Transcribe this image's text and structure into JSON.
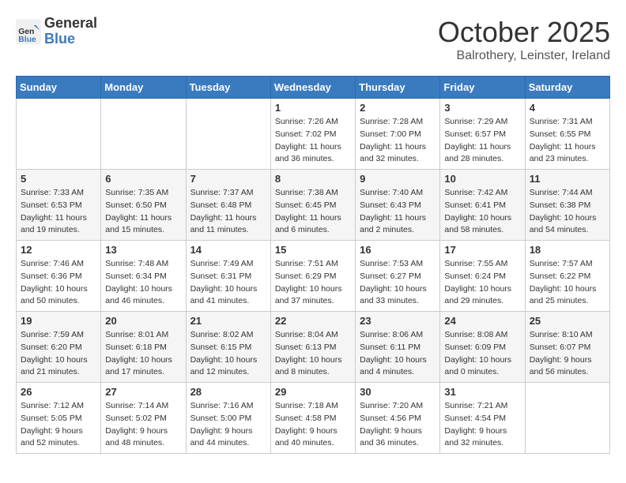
{
  "logo": {
    "general": "General",
    "blue": "Blue"
  },
  "title": "October 2025",
  "subtitle": "Balrothery, Leinster, Ireland",
  "days_of_week": [
    "Sunday",
    "Monday",
    "Tuesday",
    "Wednesday",
    "Thursday",
    "Friday",
    "Saturday"
  ],
  "weeks": [
    [
      {
        "day": "",
        "info": ""
      },
      {
        "day": "",
        "info": ""
      },
      {
        "day": "",
        "info": ""
      },
      {
        "day": "1",
        "info": "Sunrise: 7:26 AM\nSunset: 7:02 PM\nDaylight: 11 hours\nand 36 minutes."
      },
      {
        "day": "2",
        "info": "Sunrise: 7:28 AM\nSunset: 7:00 PM\nDaylight: 11 hours\nand 32 minutes."
      },
      {
        "day": "3",
        "info": "Sunrise: 7:29 AM\nSunset: 6:57 PM\nDaylight: 11 hours\nand 28 minutes."
      },
      {
        "day": "4",
        "info": "Sunrise: 7:31 AM\nSunset: 6:55 PM\nDaylight: 11 hours\nand 23 minutes."
      }
    ],
    [
      {
        "day": "5",
        "info": "Sunrise: 7:33 AM\nSunset: 6:53 PM\nDaylight: 11 hours\nand 19 minutes."
      },
      {
        "day": "6",
        "info": "Sunrise: 7:35 AM\nSunset: 6:50 PM\nDaylight: 11 hours\nand 15 minutes."
      },
      {
        "day": "7",
        "info": "Sunrise: 7:37 AM\nSunset: 6:48 PM\nDaylight: 11 hours\nand 11 minutes."
      },
      {
        "day": "8",
        "info": "Sunrise: 7:38 AM\nSunset: 6:45 PM\nDaylight: 11 hours\nand 6 minutes."
      },
      {
        "day": "9",
        "info": "Sunrise: 7:40 AM\nSunset: 6:43 PM\nDaylight: 11 hours\nand 2 minutes."
      },
      {
        "day": "10",
        "info": "Sunrise: 7:42 AM\nSunset: 6:41 PM\nDaylight: 10 hours\nand 58 minutes."
      },
      {
        "day": "11",
        "info": "Sunrise: 7:44 AM\nSunset: 6:38 PM\nDaylight: 10 hours\nand 54 minutes."
      }
    ],
    [
      {
        "day": "12",
        "info": "Sunrise: 7:46 AM\nSunset: 6:36 PM\nDaylight: 10 hours\nand 50 minutes."
      },
      {
        "day": "13",
        "info": "Sunrise: 7:48 AM\nSunset: 6:34 PM\nDaylight: 10 hours\nand 46 minutes."
      },
      {
        "day": "14",
        "info": "Sunrise: 7:49 AM\nSunset: 6:31 PM\nDaylight: 10 hours\nand 41 minutes."
      },
      {
        "day": "15",
        "info": "Sunrise: 7:51 AM\nSunset: 6:29 PM\nDaylight: 10 hours\nand 37 minutes."
      },
      {
        "day": "16",
        "info": "Sunrise: 7:53 AM\nSunset: 6:27 PM\nDaylight: 10 hours\nand 33 minutes."
      },
      {
        "day": "17",
        "info": "Sunrise: 7:55 AM\nSunset: 6:24 PM\nDaylight: 10 hours\nand 29 minutes."
      },
      {
        "day": "18",
        "info": "Sunrise: 7:57 AM\nSunset: 6:22 PM\nDaylight: 10 hours\nand 25 minutes."
      }
    ],
    [
      {
        "day": "19",
        "info": "Sunrise: 7:59 AM\nSunset: 6:20 PM\nDaylight: 10 hours\nand 21 minutes."
      },
      {
        "day": "20",
        "info": "Sunrise: 8:01 AM\nSunset: 6:18 PM\nDaylight: 10 hours\nand 17 minutes."
      },
      {
        "day": "21",
        "info": "Sunrise: 8:02 AM\nSunset: 6:15 PM\nDaylight: 10 hours\nand 12 minutes."
      },
      {
        "day": "22",
        "info": "Sunrise: 8:04 AM\nSunset: 6:13 PM\nDaylight: 10 hours\nand 8 minutes."
      },
      {
        "day": "23",
        "info": "Sunrise: 8:06 AM\nSunset: 6:11 PM\nDaylight: 10 hours\nand 4 minutes."
      },
      {
        "day": "24",
        "info": "Sunrise: 8:08 AM\nSunset: 6:09 PM\nDaylight: 10 hours\nand 0 minutes."
      },
      {
        "day": "25",
        "info": "Sunrise: 8:10 AM\nSunset: 6:07 PM\nDaylight: 9 hours\nand 56 minutes."
      }
    ],
    [
      {
        "day": "26",
        "info": "Sunrise: 7:12 AM\nSunset: 5:05 PM\nDaylight: 9 hours\nand 52 minutes."
      },
      {
        "day": "27",
        "info": "Sunrise: 7:14 AM\nSunset: 5:02 PM\nDaylight: 9 hours\nand 48 minutes."
      },
      {
        "day": "28",
        "info": "Sunrise: 7:16 AM\nSunset: 5:00 PM\nDaylight: 9 hours\nand 44 minutes."
      },
      {
        "day": "29",
        "info": "Sunrise: 7:18 AM\nSunset: 4:58 PM\nDaylight: 9 hours\nand 40 minutes."
      },
      {
        "day": "30",
        "info": "Sunrise: 7:20 AM\nSunset: 4:56 PM\nDaylight: 9 hours\nand 36 minutes."
      },
      {
        "day": "31",
        "info": "Sunrise: 7:21 AM\nSunset: 4:54 PM\nDaylight: 9 hours\nand 32 minutes."
      },
      {
        "day": "",
        "info": ""
      }
    ]
  ]
}
